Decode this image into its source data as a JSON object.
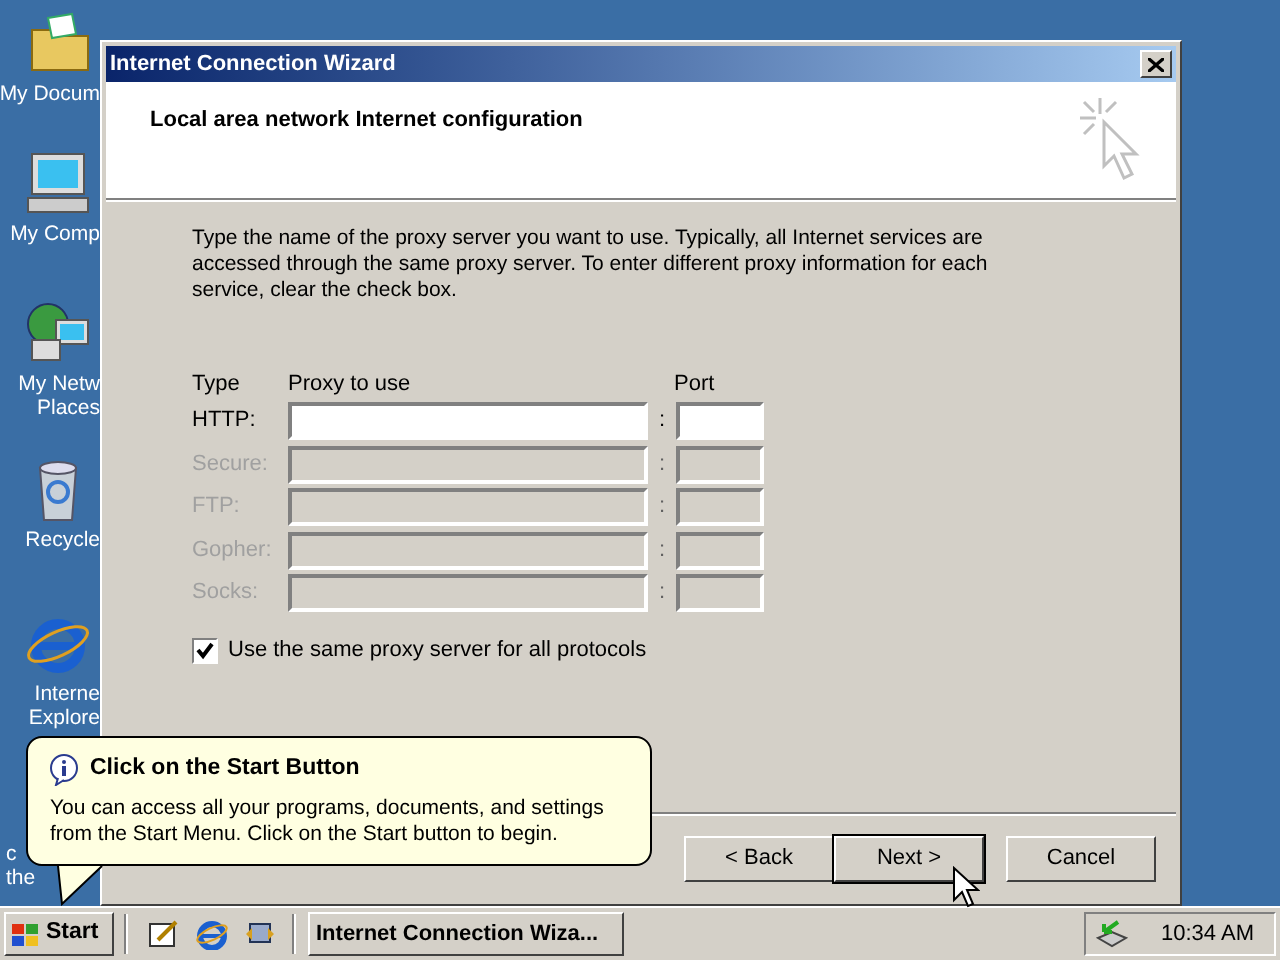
{
  "desktop_icons": [
    {
      "kind": "folder",
      "label_lines": [
        "My Docum"
      ]
    },
    {
      "kind": "computer",
      "label_lines": [
        "My Comp"
      ]
    },
    {
      "kind": "network",
      "label_lines": [
        "My Netw",
        "Places"
      ]
    },
    {
      "kind": "recycle",
      "label_lines": [
        "Recycle"
      ]
    },
    {
      "kind": "browser",
      "label_lines": [
        "Interne",
        "Explore"
      ]
    },
    {
      "kind": "hidden",
      "label_lines": [
        "c",
        "the"
      ]
    }
  ],
  "window": {
    "title": "Internet Connection Wizard",
    "header_title": "Local area network Internet configuration",
    "instructions": "Type the name of the proxy server you want to use. Typically, all Internet services are accessed through the same proxy server. To enter different proxy information for each service, clear the check box.",
    "columns": [
      "Type",
      "Proxy to use",
      "Port"
    ],
    "protocols": [
      {
        "label": "HTTP:",
        "separator": ":",
        "disabled": false
      },
      {
        "label": "Secure:",
        "separator": ":",
        "disabled": true
      },
      {
        "label": "FTP:",
        "separator": ":",
        "disabled": true
      },
      {
        "label": "Gopher:",
        "separator": ":",
        "disabled": true
      },
      {
        "label": "Socks:",
        "separator": ":",
        "disabled": true
      }
    ],
    "same_proxy": {
      "label": "Use the same proxy server for all protocols",
      "checked": true
    },
    "buttons": [
      {
        "label": "< Back",
        "default": false
      },
      {
        "label": "Next >",
        "default": true
      },
      {
        "label": "Cancel",
        "default": false
      }
    ]
  },
  "balloon": {
    "title": "Click on the Start Button",
    "text": "You can access all your programs, documents, and settings from the Start Menu. Click on the Start button to begin."
  },
  "taskbar": {
    "start": "Start",
    "tasks": [
      {
        "label": "Internet Connection Wiza...",
        "selected": false
      }
    ],
    "clock": "10:34 AM"
  }
}
